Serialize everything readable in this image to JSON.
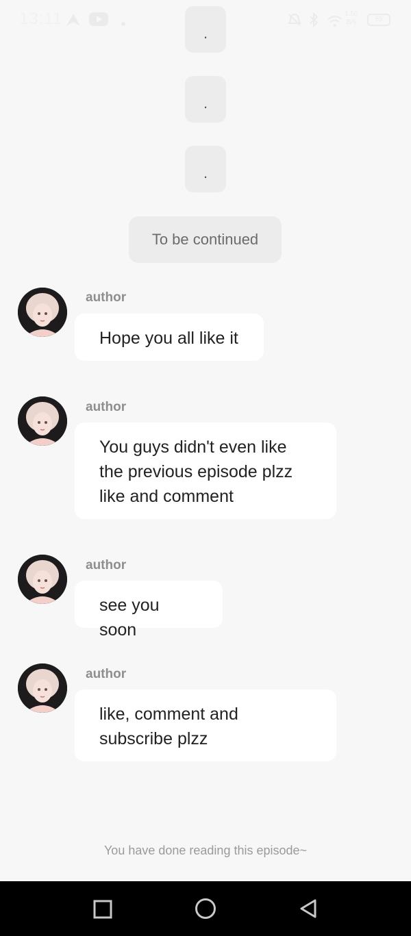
{
  "status_bar": {
    "time": "13:11",
    "network_speed_value": "1.50",
    "network_speed_unit": "B/s",
    "battery": "55",
    "icons": [
      "navigation-icon",
      "youtube-icon",
      "dot-icon",
      "alarm-off-icon",
      "bluetooth-icon",
      "wifi-icon",
      "battery-icon"
    ]
  },
  "narration": {
    "dots": [
      ".",
      ".",
      "."
    ],
    "continued": "To be continued"
  },
  "messages": [
    {
      "sender": "author",
      "text": "Hope you all like it"
    },
    {
      "sender": "author",
      "text": "You guys didn't even like the previous episode plzz like and comment"
    },
    {
      "sender": "author",
      "text": "see you soon"
    },
    {
      "sender": "author",
      "text": "like, comment and subscribe plzz"
    }
  ],
  "footer": {
    "done_text": "You have done reading this episode~"
  },
  "nav_bar": {
    "buttons": [
      "recent-apps-icon",
      "home-icon",
      "back-icon"
    ]
  }
}
